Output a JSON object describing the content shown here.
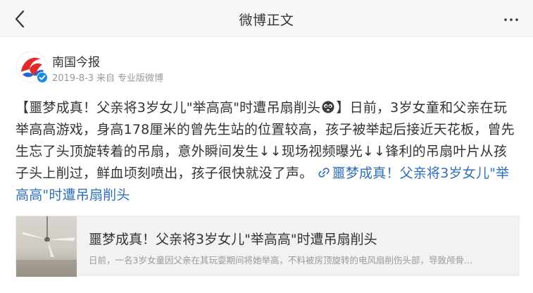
{
  "header": {
    "title": "微博正文",
    "back_icon": "chevron-left-icon",
    "more_icon": "ellipsis-icon"
  },
  "author": {
    "name": "南国今报",
    "date": "2019-8-3",
    "source_prefix": "来自",
    "source": "专业版微博",
    "verified": true,
    "avatar_colors": {
      "red": "#e02b2b",
      "blue": "#2a64c8",
      "badge": "#1d8be0"
    }
  },
  "post": {
    "bracket_open": "【",
    "headline": "噩梦成真！父亲将3岁女儿\"举高高\"时遭吊扇削头",
    "bracket_close": "】",
    "body": "日前，3岁女童和父亲在玩举高高游戏，身高178厘米的曾先生站的位置较高，孩子被举起后接近天花板，曾先生忘了头顶旋转着的吊扇，意外瞬间发生↓↓现场视频曝光↓↓锋利的吊扇叶片从孩子头上削过，鲜血顷刻喷出，孩子很快就没了声。",
    "link_text": "噩梦成真！父亲将3岁女儿\"举高高\"时遭吊扇削头",
    "emoji_icon": "crying-face-icon",
    "link_icon": "link-icon",
    "link_color": "#2f6fb7"
  },
  "card": {
    "title": "噩梦成真！父亲将3岁女儿\"举高高\"时遭吊扇削头",
    "summary": "日前，一名3岁女童因父亲在其玩耍期间将她举高，不料被房顶旋转的电风扇削伤头部，导致颅骨…",
    "thumb_icon": "ceiling-fan-thumbnail"
  }
}
